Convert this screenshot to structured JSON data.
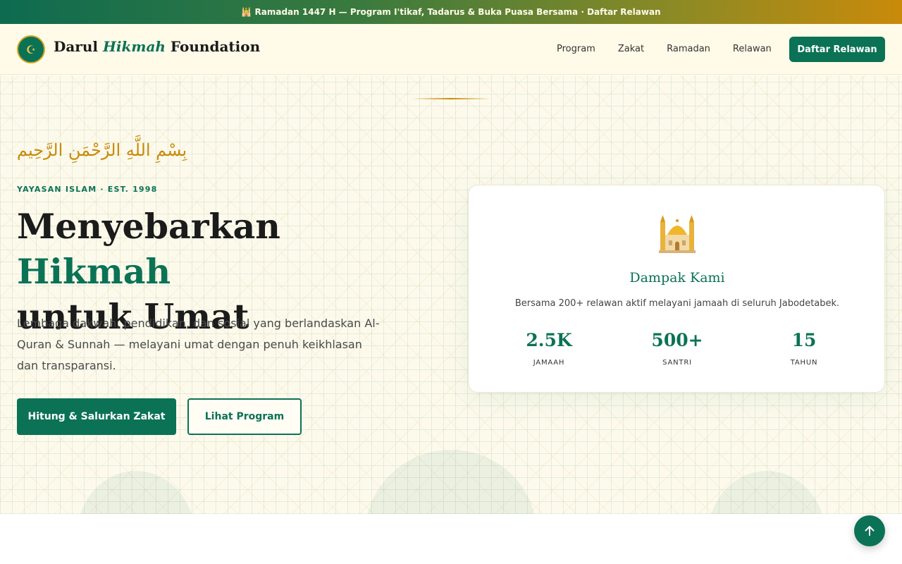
{
  "announcement": {
    "icon": "mosque-emoji-icon",
    "text": "🕌 Ramadan 1447 H — Program I'tikaf, Tadarus & Buka Puasa Bersama · Daftar Relawan"
  },
  "header": {
    "logo_icon": "crescent-moon-icon",
    "brand_prefix": "Darul ",
    "brand_accent": "Hikmah",
    "brand_suffix": " Foundation",
    "nav": [
      "Program",
      "Zakat",
      "Ramadan",
      "Relawan"
    ],
    "cta_label": "Daftar Relawan"
  },
  "hero": {
    "arabic": "بِسْمِ اللَّهِ الرَّحْمَنِ الرَّحِيم",
    "eyebrow": "YAYASAN ISLAM · EST. 1998",
    "title_part1": "Menyebarkan ",
    "title_accent": "Hikmah",
    "title_part2": "untuk Umat",
    "lead": "Lembaga dakwah, pendidikan, dan sosial yang berlandaskan Al-Quran & Sunnah — melayani umat dengan penuh keikhlasan dan transparansi.",
    "primary_button": "Hitung & Salurkan Zakat",
    "secondary_button": "Lihat Program"
  },
  "impact_card": {
    "icon": "mosque-icon",
    "title": "Dampak Kami",
    "description": "Bersama 200+ relawan aktif melayani jamaah di seluruh Jabodetabek.",
    "stats": [
      {
        "value": "2.5K",
        "label": "JAMAAH"
      },
      {
        "value": "500+",
        "label": "SANTRI"
      },
      {
        "value": "15",
        "label": "TAHUN"
      }
    ]
  },
  "scroll_top": {
    "icon": "arrow-up-icon"
  },
  "colors": {
    "primary": "#0b7255",
    "gold": "#c98a0a",
    "cream": "#fffbe8"
  }
}
